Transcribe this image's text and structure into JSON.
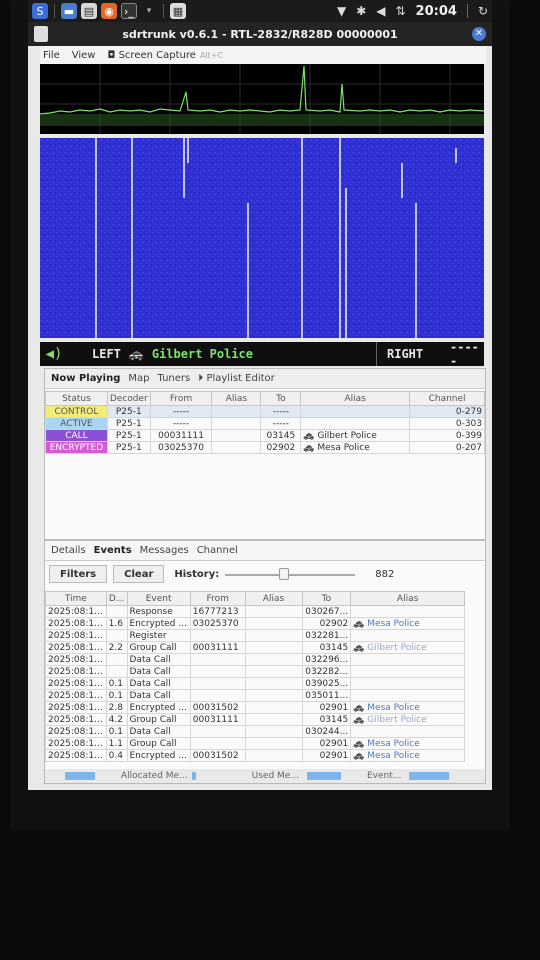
{
  "taskbar": {
    "clock": "20:04"
  },
  "window": {
    "title": "sdrtrunk v0.6.1 - RTL-2832/R828D 00000001"
  },
  "menu": {
    "file": "File",
    "view": "View",
    "screen_capture": "Screen Capture",
    "screen_capture_hint": "Alt+C"
  },
  "audio": {
    "left_label": "LEFT",
    "left_alias": "Gilbert Police",
    "right_label": "RIGHT",
    "right_value": "-----"
  },
  "main_tabs": [
    "Now Playing",
    "Map",
    "Tuners",
    "Playlist Editor"
  ],
  "now_playing": {
    "headers": [
      "Status",
      "Decoder",
      "From",
      "Alias",
      "To",
      "Alias",
      "Channel"
    ],
    "rows": [
      {
        "status": "CONTROL",
        "status_color": "#f2ec7a",
        "decoder": "P25-1",
        "from": "-----",
        "alias1": "",
        "to": "-----",
        "alias2": "",
        "channel": "0-279"
      },
      {
        "status": "ACTIVE",
        "status_color": "#a9d6f5",
        "decoder": "P25-1",
        "from": "-----",
        "alias1": "",
        "to": "-----",
        "alias2": "",
        "channel": "0-303"
      },
      {
        "status": "CALL",
        "status_color": "#8b4fd8",
        "decoder": "P25-1",
        "from": "00031111",
        "alias1": "",
        "to": "03145",
        "alias2": "Gilbert Police",
        "channel": "0-399"
      },
      {
        "status": "ENCRYPTED",
        "status_color": "#d65ad6",
        "decoder": "P25-1",
        "from": "03025370",
        "alias1": "",
        "to": "02902",
        "alias2": "Mesa Police",
        "channel": "0-207"
      }
    ]
  },
  "detail_tabs": [
    "Details",
    "Events",
    "Messages",
    "Channel"
  ],
  "events_toolbar": {
    "filters": "Filters",
    "clear": "Clear",
    "history_label": "History:",
    "history_value": "882"
  },
  "events": {
    "headers": [
      "Time",
      "D...",
      "Event",
      "From",
      "Alias",
      "To",
      "Alias"
    ],
    "rows": [
      {
        "time": "2025:08:1...",
        "d": "",
        "event": "Response",
        "from": "16777213",
        "alias1": "",
        "to": "030267...",
        "alias2": ""
      },
      {
        "time": "2025:08:1...",
        "d": "1.6",
        "event": "Encrypted ...",
        "from": "03025370",
        "alias1": "",
        "to": "02902",
        "alias2": "Mesa Police"
      },
      {
        "time": "2025:08:1...",
        "d": "",
        "event": "Register",
        "from": "",
        "alias1": "",
        "to": "032281...",
        "alias2": ""
      },
      {
        "time": "2025:08:1...",
        "d": "2.2",
        "event": "Group Call",
        "from": "00031111",
        "alias1": "",
        "to": "03145",
        "alias2": "Gilbert Police"
      },
      {
        "time": "2025:08:1...",
        "d": "",
        "event": "Data Call",
        "from": "",
        "alias1": "",
        "to": "032296...",
        "alias2": ""
      },
      {
        "time": "2025:08:1...",
        "d": "",
        "event": "Data Call",
        "from": "",
        "alias1": "",
        "to": "032282...",
        "alias2": ""
      },
      {
        "time": "2025:08:1...",
        "d": "0.1",
        "event": "Data Call",
        "from": "",
        "alias1": "",
        "to": "039025...",
        "alias2": ""
      },
      {
        "time": "2025:08:1...",
        "d": "0.1",
        "event": "Data Call",
        "from": "",
        "alias1": "",
        "to": "035011...",
        "alias2": ""
      },
      {
        "time": "2025:08:1...",
        "d": "2.8",
        "event": "Encrypted ...",
        "from": "00031502",
        "alias1": "",
        "to": "02901",
        "alias2": "Mesa Police"
      },
      {
        "time": "2025:08:1...",
        "d": "4.2",
        "event": "Group Call",
        "from": "00031111",
        "alias1": "",
        "to": "03145",
        "alias2": "Gilbert Police"
      },
      {
        "time": "2025:08:1...",
        "d": "0.1",
        "event": "Data Call",
        "from": "",
        "alias1": "",
        "to": "030244...",
        "alias2": ""
      },
      {
        "time": "2025:08:1...",
        "d": "1.1",
        "event": "Group Call",
        "from": "",
        "alias1": "",
        "to": "02901",
        "alias2": "Mesa Police"
      },
      {
        "time": "2025:08:1...",
        "d": "0.4",
        "event": "Encrypted ...",
        "from": "00031502",
        "alias1": "",
        "to": "02901",
        "alias2": "Mesa Police"
      }
    ]
  },
  "footer": {
    "allocated": "Allocated Me...",
    "used": "Used Me...",
    "event": "Event..."
  }
}
